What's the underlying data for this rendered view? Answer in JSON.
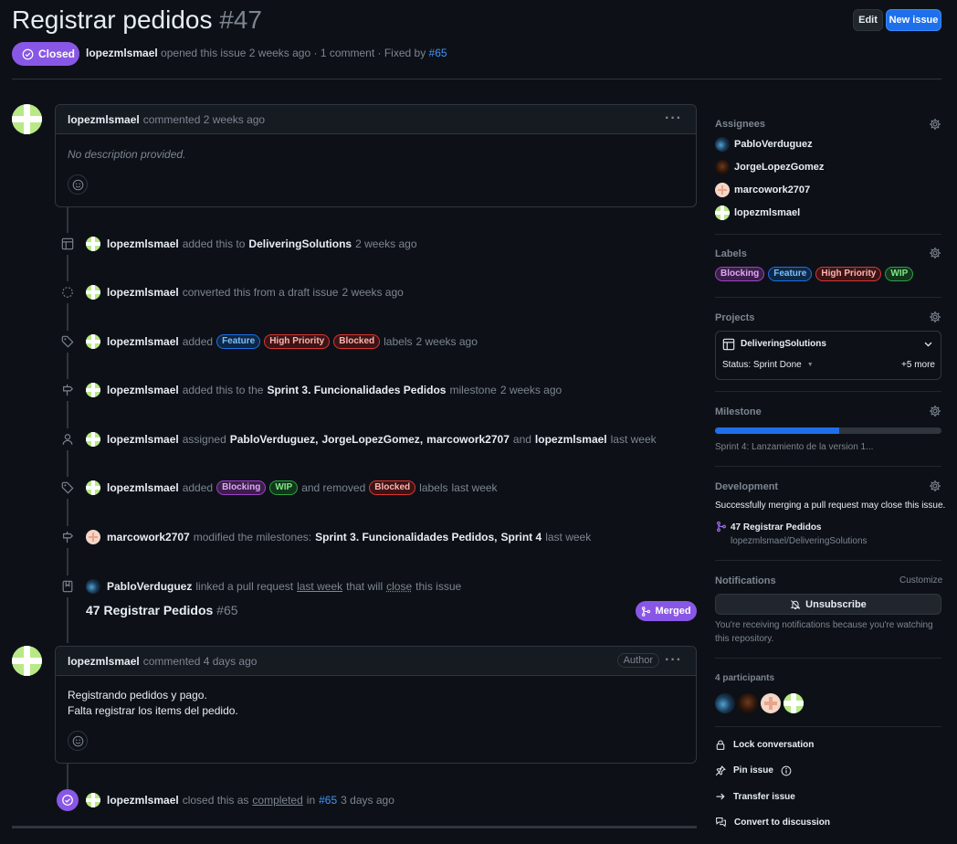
{
  "issue": {
    "title": "Registrar pedidos",
    "number": "#47",
    "state": "Closed",
    "author": "lopezmlsmael",
    "meta_text": "opened this issue 2 weeks ago · 1 comment · Fixed by",
    "fixed_by": "#65"
  },
  "header_buttons": {
    "edit": "Edit",
    "new_issue": "New issue"
  },
  "first_comment": {
    "author": "lopezmlsmael",
    "time": "commented 2 weeks ago",
    "body": "No description provided."
  },
  "events": [
    {
      "user": "lopezmlsmael",
      "text1": "added this to",
      "target": "DeliveringSolutions",
      "time": "2 weeks ago"
    },
    {
      "user": "lopezmlsmael",
      "text1": "converted this from a draft issue",
      "time": "2 weeks ago"
    },
    {
      "user": "lopezmlsmael",
      "text1": "added",
      "labels": [
        "Feature",
        "High Priority",
        "Blocked"
      ],
      "text2": "labels",
      "time": "2 weeks ago"
    },
    {
      "user": "lopezmlsmael",
      "text1": "added this to the",
      "target": "Sprint 3. Funcionalidades Pedidos",
      "text2": "milestone",
      "time": "2 weeks ago"
    },
    {
      "user": "lopezmlsmael",
      "text1": "assigned",
      "assignees": [
        "PabloVerduguez",
        "JorgeLopezGomez",
        "marcowork2707"
      ],
      "and": "and",
      "last": "lopezmlsmael",
      "time": "last week"
    },
    {
      "user": "lopezmlsmael",
      "text1": "added",
      "labels": [
        "Blocking",
        "WIP"
      ],
      "text2": "and removed",
      "removed": [
        "Blocked"
      ],
      "text3": "labels",
      "time": "last week"
    },
    {
      "user": "marcowork2707",
      "text1": "modified the milestones:",
      "m1": "Sprint 3. Funcionalidades Pedidos",
      "m2": "Sprint 4",
      "time": "last week"
    },
    {
      "user": "PabloVerduguez",
      "text1": "linked a pull request",
      "when": "last week",
      "text2": "that will",
      "close": "close",
      "text3": "this issue"
    }
  ],
  "pull_request": {
    "title": "47 Registrar Pedidos",
    "number": "#65",
    "status": "Merged"
  },
  "second_comment": {
    "author": "lopezmlsmael",
    "time": "commented 4 days ago",
    "badge": "Author",
    "lines": [
      "Registrando pedidos y pago.",
      "Falta registrar los items del pedido."
    ]
  },
  "closed_event": {
    "user": "lopezmlsmael",
    "text1": "closed this as",
    "reason": "completed",
    "text2": "in",
    "ref": "#65",
    "time": "3 days ago"
  },
  "sidebar": {
    "assignees": {
      "title": "Assignees",
      "people": [
        "PabloVerduguez",
        "JorgeLopezGomez",
        "marcowork2707",
        "lopezmlsmael"
      ]
    },
    "labels": {
      "title": "Labels",
      "items": [
        "Blocking",
        "Feature",
        "High Priority",
        "WIP"
      ]
    },
    "projects": {
      "title": "Projects",
      "name": "DeliveringSolutions",
      "status": "Status: Sprint Done",
      "more": "+5 more"
    },
    "milestone": {
      "title": "Milestone",
      "progress": 0.55,
      "name": "Sprint 4: Lanzamiento de la version 1..."
    },
    "development": {
      "title": "Development",
      "note": "Successfully merging a pull request may close this issue.",
      "pr": "47 Registrar Pedidos",
      "repo": "lopezmlsmael/DeliveringSolutions"
    },
    "notifications": {
      "title": "Notifications",
      "customize": "Customize",
      "button": "Unsubscribe",
      "note1": "You're receiving notifications because you're watching",
      "note2": "this repository."
    },
    "participants": {
      "title": "4 participants"
    },
    "actions": [
      "Lock conversation",
      "Pin issue",
      "Transfer issue",
      "Convert to discussion"
    ]
  },
  "colors": {
    "accent": "#1f6feb",
    "closed": "#8957e5",
    "bg": "#0d1117"
  }
}
